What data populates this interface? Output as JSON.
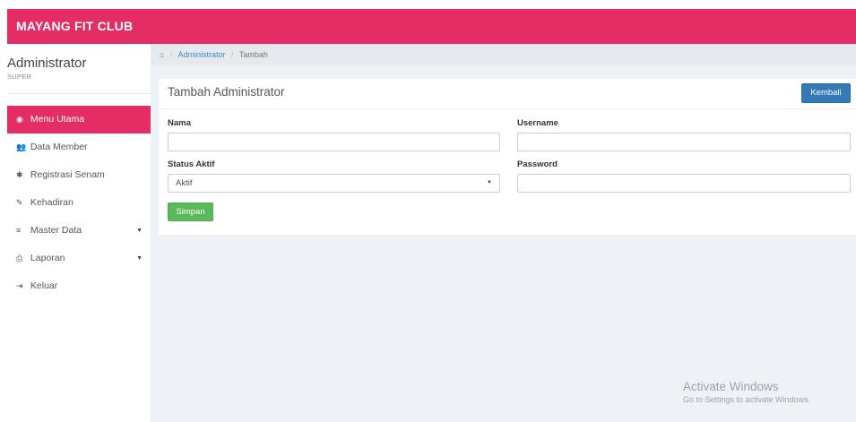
{
  "app": {
    "brand": "MAYANG FIT CLUB"
  },
  "user": {
    "name": "Administrator",
    "role": "SUPER"
  },
  "sidebar": {
    "items": [
      {
        "label": "Menu Utama",
        "icon": "dashboard-icon",
        "glyph": "◉"
      },
      {
        "label": "Data Member",
        "icon": "users-icon",
        "glyph": "👥"
      },
      {
        "label": "Registrasi Senam",
        "icon": "gear-icon",
        "glyph": "✱"
      },
      {
        "label": "Kehadiran",
        "icon": "edit-icon",
        "glyph": "✎"
      },
      {
        "label": "Master Data",
        "icon": "database-icon",
        "glyph": "≡"
      },
      {
        "label": "Laporan",
        "icon": "print-icon",
        "glyph": "⎙"
      },
      {
        "label": "Keluar",
        "icon": "sign-out-icon",
        "glyph": "⇥"
      }
    ]
  },
  "breadcrumb": {
    "home_icon": "home-icon",
    "link": "Administrator",
    "current": "Tambah"
  },
  "panel": {
    "title": "Tambah Administrator",
    "back_label": "Kembali"
  },
  "form": {
    "nama_label": "Nama",
    "nama_value": "",
    "username_label": "Username",
    "username_value": "",
    "status_label": "Status Aktif",
    "status_value": "Aktif",
    "password_label": "Password",
    "password_value": "",
    "submit_label": "Simpan"
  },
  "watermark": {
    "title": "Activate Windows",
    "subtitle": "Go to Settings to activate Windows."
  },
  "colors": {
    "brand": "#e42d65",
    "primary": "#337ab7",
    "success": "#5cb85c"
  }
}
